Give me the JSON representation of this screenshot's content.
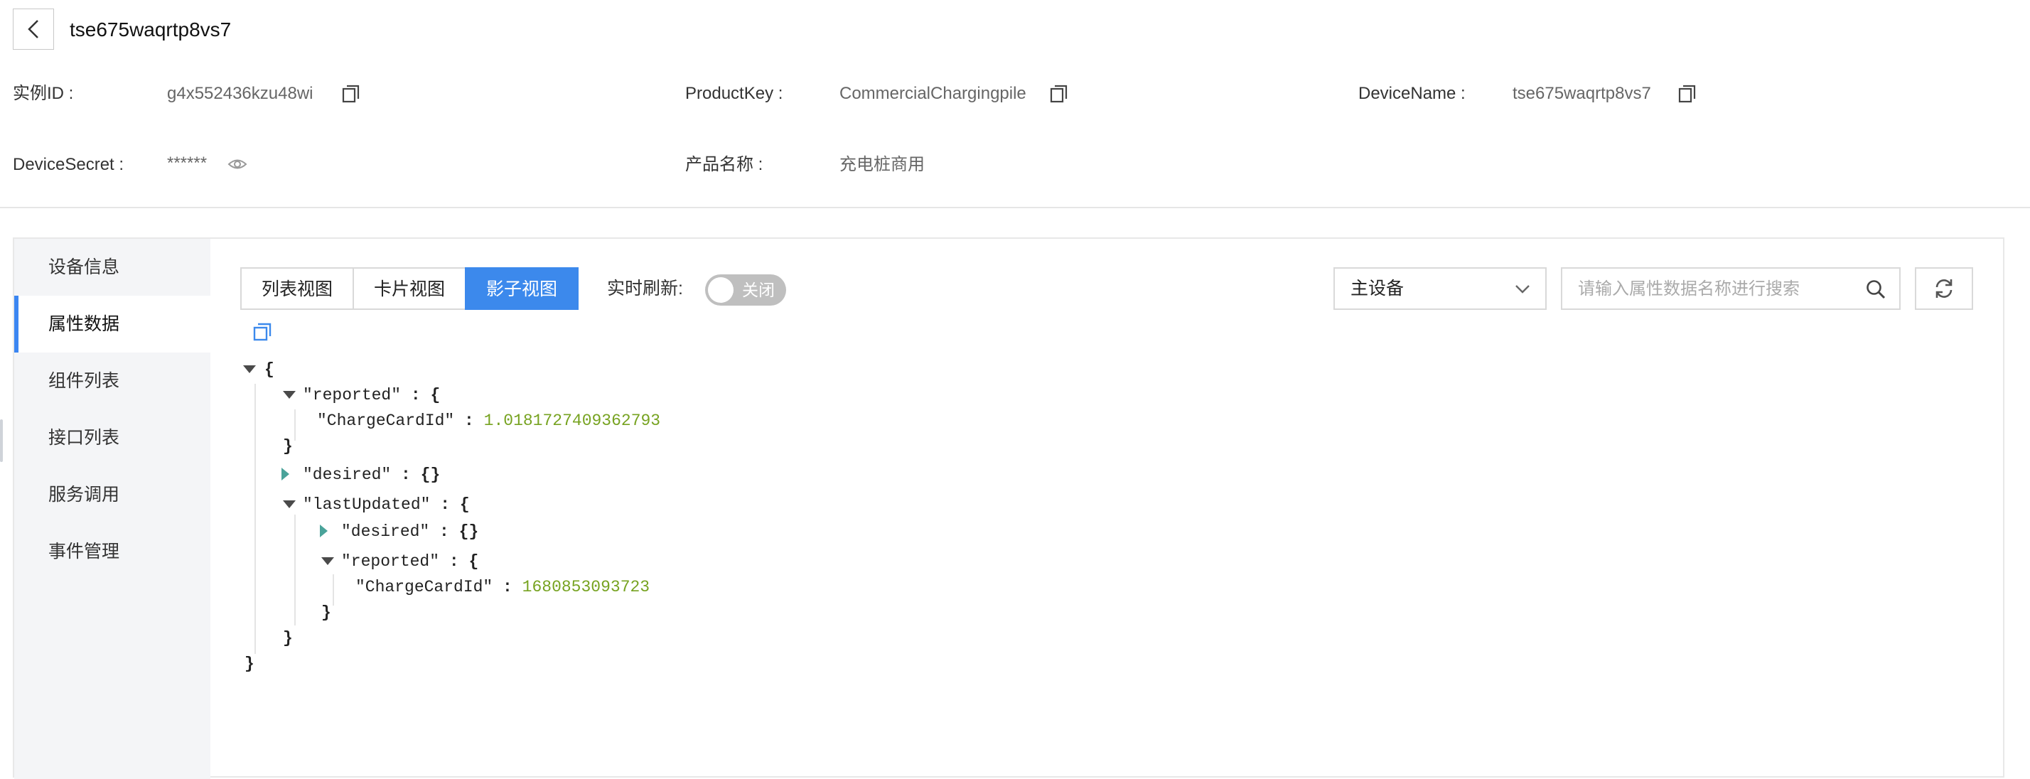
{
  "header": {
    "title": "tse675waqrtp8vs7",
    "back_icon": "chevron-left-icon"
  },
  "info": {
    "instance_id": {
      "label": "实例ID :",
      "value": "g4x552436kzu48wi"
    },
    "product_key": {
      "label": "ProductKey :",
      "value": "CommercialChargingpile"
    },
    "device_name": {
      "label": "DeviceName :",
      "value": "tse675waqrtp8vs7"
    },
    "device_secret": {
      "label": "DeviceSecret :",
      "value": "******"
    },
    "product_name": {
      "label": "产品名称 :",
      "value": "充电桩商用"
    }
  },
  "sidebar": {
    "items": [
      {
        "label": "设备信息",
        "active": false
      },
      {
        "label": "属性数据",
        "active": true
      },
      {
        "label": "组件列表",
        "active": false
      },
      {
        "label": "接口列表",
        "active": false
      },
      {
        "label": "服务调用",
        "active": false
      },
      {
        "label": "事件管理",
        "active": false
      }
    ]
  },
  "tabs": [
    {
      "label": "列表视图",
      "active": false
    },
    {
      "label": "卡片视图",
      "active": false
    },
    {
      "label": "影子视图",
      "active": true
    }
  ],
  "realtime": {
    "label": "实时刷新:",
    "toggle_text": "关闭",
    "enabled": false
  },
  "device_select": {
    "value": "主设备"
  },
  "search": {
    "placeholder": "请输入属性数据名称进行搜索"
  },
  "json_view": {
    "open_brace": "{",
    "close_brace": "}",
    "reported_key": "\"reported\"",
    "reported_child_key": "\"ChargeCardId\"",
    "reported_child_value": "1.0181727409362793",
    "desired_key": "\"desired\"",
    "desired_value": "{}",
    "last_updated_key": "\"lastUpdated\"",
    "lu_desired_key": "\"desired\"",
    "lu_desired_value": "{}",
    "lu_reported_key": "\"reported\"",
    "lu_reported_child_key": "\"ChargeCardId\"",
    "lu_reported_child_value": "1680853093723",
    "colon": ":",
    "colon_brace": ": {"
  },
  "colors": {
    "accent": "#3c89ec",
    "number": "#77a321",
    "toggle_off": "#bfbfbf"
  }
}
